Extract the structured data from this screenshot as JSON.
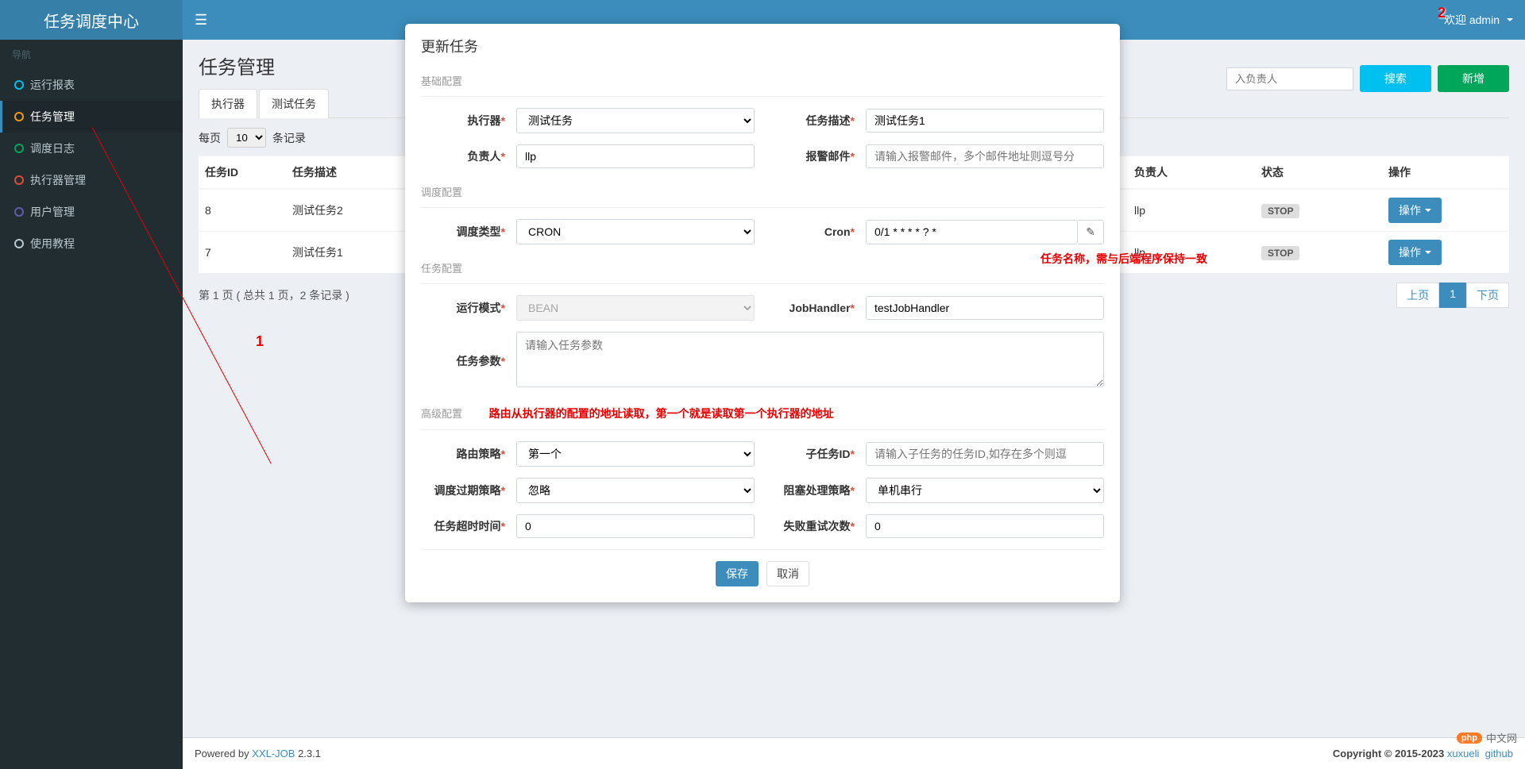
{
  "brand": "任务调度中心",
  "user": {
    "greeting": "欢迎 admin"
  },
  "sidebar": {
    "header": "导航",
    "items": [
      {
        "label": "运行报表",
        "ring": "#00c0ef"
      },
      {
        "label": "任务管理",
        "ring": "#f39c12",
        "active": true
      },
      {
        "label": "调度日志",
        "ring": "#00a65a"
      },
      {
        "label": "执行器管理",
        "ring": "#dd4b39"
      },
      {
        "label": "用户管理",
        "ring": "#605ca8"
      },
      {
        "label": "使用教程",
        "ring": "#b8c7ce"
      }
    ]
  },
  "page": {
    "title": "任务管理",
    "tabs": [
      "执行器",
      "测试任务"
    ],
    "pager": {
      "prefix": "每页",
      "size": "10",
      "suffix": "条记录"
    },
    "search_placeholder": "入负责人",
    "btn_search": "搜索",
    "btn_add": "新增",
    "columns": {
      "id": "任务ID",
      "desc": "任务描述",
      "owner": "负责人",
      "status": "状态",
      "op": "操作"
    },
    "rows": [
      {
        "id": "8",
        "desc": "测试任务2",
        "owner": "llp",
        "status": "STOP",
        "op": "操作"
      },
      {
        "id": "7",
        "desc": "测试任务1",
        "owner": "llp",
        "status": "STOP",
        "op": "操作"
      }
    ],
    "summary": "第 1 页 ( 总共 1 页，2 条记录 )",
    "pagination": {
      "prev": "上页",
      "pages": [
        "1"
      ],
      "next": "下页"
    }
  },
  "modal": {
    "title": "更新任务",
    "s1": "基础配置",
    "executor_lbl": "执行器",
    "executor_val": "测试任务",
    "desc_lbl": "任务描述",
    "desc_val": "测试任务1",
    "owner_lbl": "负责人",
    "owner_val": "llp",
    "alarm_lbl": "报警邮件",
    "alarm_ph": "请输入报警邮件，多个邮件地址则逗号分",
    "s2": "调度配置",
    "sched_type_lbl": "调度类型",
    "sched_type_val": "CRON",
    "cron_lbl": "Cron",
    "cron_val": "0/1 * * * * ? *",
    "s3": "任务配置",
    "mode_lbl": "运行模式",
    "mode_val": "BEAN",
    "handler_lbl": "JobHandler",
    "handler_val": "testJobHandler",
    "params_lbl": "任务参数",
    "params_ph": "请输入任务参数",
    "s4": "高级配置",
    "route_lbl": "路由策略",
    "route_val": "第一个",
    "child_lbl": "子任务ID",
    "child_ph": "请输入子任务的任务ID,如存在多个则逗",
    "expire_lbl": "调度过期策略",
    "expire_val": "忽略",
    "block_lbl": "阻塞处理策略",
    "block_val": "单机串行",
    "timeout_lbl": "任务超时时间",
    "timeout_val": "0",
    "retry_lbl": "失败重试次数",
    "retry_val": "0",
    "save": "保存",
    "cancel": "取消"
  },
  "anno": {
    "n1": "1",
    "n2": "2",
    "handler_note": "任务名称，需与后端程序保持一致",
    "route_note": "路由从执行器的配置的地址读取，第一个就是读取第一个执行器的地址"
  },
  "footer": {
    "left_pre": "Powered by ",
    "left_link": "XXL-JOB",
    "left_ver": " 2.3.1",
    "right_pre": "Copyright © 2015-2023  ",
    "right_l1": "xuxueli",
    "right_l2": "github"
  },
  "wm": "中文网"
}
